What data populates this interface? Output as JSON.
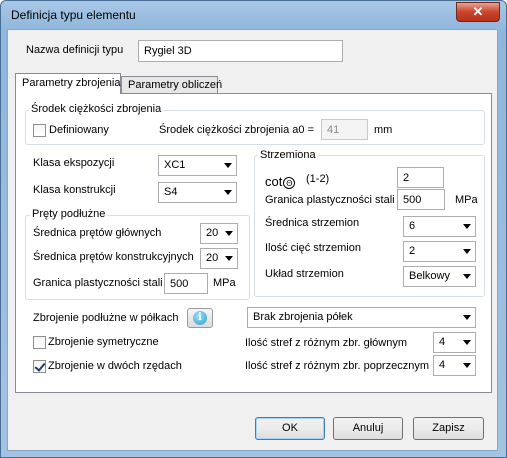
{
  "window": {
    "title": "Definicja typu elementu",
    "close_glyph": "✕"
  },
  "name_field": {
    "label": "Nazwa definicji typu",
    "value": "Rygiel 3D"
  },
  "tabs": [
    {
      "label": "Parametry zbrojenia",
      "active": true
    },
    {
      "label": "Parametry obliczeń",
      "active": false
    }
  ],
  "srodek": {
    "group_title": "Środek ciężkości zbrojenia",
    "checkbox_label": "Definiowany",
    "checked": false,
    "field_label": "Środek ciężkości zbrojenia a0 =",
    "value": "41",
    "unit": "mm"
  },
  "klasa": {
    "ekspozycji_label": "Klasa ekspozycji",
    "ekspozycji_value": "XC1",
    "konstrukcji_label": "Klasa konstrukcji",
    "konstrukcji_value": "S4"
  },
  "prety": {
    "group_title": "Pręty podłużne",
    "glowne_label": "Średnica prętów głównych",
    "glowne_value": "20",
    "konstr_label": "Średnica prętów konstrukcyjnych",
    "konstr_value": "20",
    "granica_label": "Granica plastyczności stali",
    "granica_value": "500",
    "granica_unit": "MPa"
  },
  "strzemiona": {
    "group_title": "Strzemiona",
    "cot_symbol": "cot",
    "theta_symbol": "Θ",
    "cot_range": "(1-2)",
    "cot_value": "2",
    "granica_label": "Granica plastyczności stali",
    "granica_value": "500",
    "granica_unit": "MPa",
    "srednica_label": "Średnica strzemion",
    "srednica_value": "6",
    "ilosc_label": "Ilość cięć strzemion",
    "ilosc_value": "2",
    "uklad_label": "Układ strzemion",
    "uklad_value": "Belkowy"
  },
  "polki": {
    "label": "Zbrojenie podłużne w półkach",
    "info_glyph": "i",
    "value": "Brak zbrojenia półek"
  },
  "sym": {
    "label": "Zbrojenie symetryczne",
    "checked": false
  },
  "dwa": {
    "label": "Zbrojenie w dwóch rzędach",
    "checked": true
  },
  "strefy": {
    "glowne_label": "Ilość stref z różnym zbr. głównym",
    "glowne_value": "4",
    "poprz_label": "Ilość stref z różnym zbr. poprzecznym",
    "poprz_value": "4"
  },
  "buttons": {
    "ok": "OK",
    "cancel": "Anuluj",
    "save": "Zapisz"
  }
}
